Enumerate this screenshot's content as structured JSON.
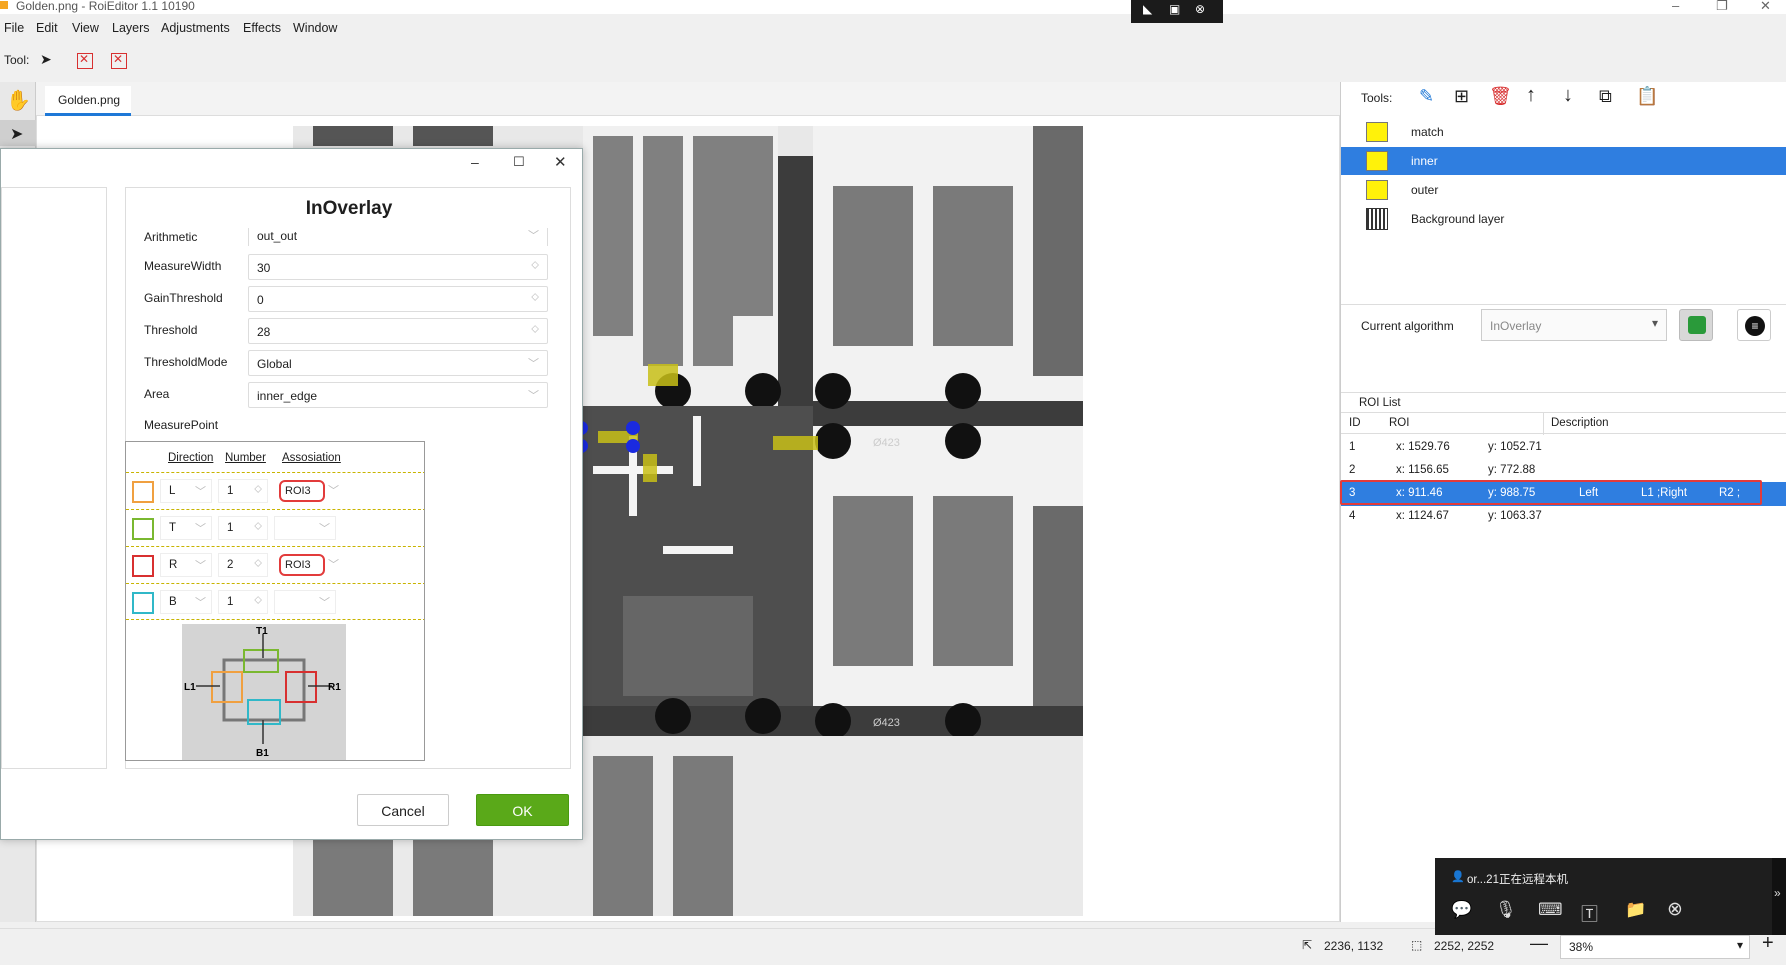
{
  "window": {
    "title": "Golden.png - RoiEditor 1.1 10190",
    "controls": [
      "–",
      "❐",
      "✕"
    ]
  },
  "menu": [
    "File",
    "Edit",
    "View",
    "Layers",
    "Adjustments",
    "Effects",
    "Window"
  ],
  "toolbar": {
    "tool_label": "Tool:"
  },
  "document_tab": "Golden.png",
  "right_panel": {
    "tools_label": "Tools:",
    "layers": [
      {
        "name": "match",
        "color": "#fff20a"
      },
      {
        "name": "inner",
        "color": "#fff20a",
        "selected": true
      },
      {
        "name": "outer",
        "color": "#fff20a"
      },
      {
        "name": "Background layer"
      }
    ],
    "current_algorithm_label": "Current algorithm",
    "current_algorithm_value": "InOverlay",
    "roi_list_title": "ROI List",
    "roi_columns": [
      "ID",
      "ROI",
      "Description"
    ],
    "roi_rows": [
      {
        "id": "1",
        "x": "x: 1529.76",
        "y": "y: 1052.71",
        "desc1": "",
        "desc2": "",
        "desc3": ""
      },
      {
        "id": "2",
        "x": "x: 1156.65",
        "y": "y: 772.88",
        "desc1": "",
        "desc2": "",
        "desc3": ""
      },
      {
        "id": "3",
        "x": "x: 911.46",
        "y": "y: 988.75",
        "desc1": "Left",
        "desc2": "L1 ;Right",
        "desc3": "R2 ;"
      },
      {
        "id": "4",
        "x": "x: 1124.67",
        "y": "y: 1063.37",
        "desc1": "",
        "desc2": "",
        "desc3": ""
      }
    ],
    "selected_roi": "3"
  },
  "image_labels": {
    "pad_label_1": "Ø423",
    "pad_label_2": "Ø423"
  },
  "dialog": {
    "title": "InOverlay",
    "properties": [
      {
        "label": "Arithmetic",
        "value": "out_out",
        "kind": "combo"
      },
      {
        "label": "MeasureWidth",
        "value": "30",
        "kind": "spin"
      },
      {
        "label": "GainThreshold",
        "value": "0",
        "kind": "spin"
      },
      {
        "label": "Threshold",
        "value": "28",
        "kind": "spin"
      },
      {
        "label": "ThresholdMode",
        "value": "Global",
        "kind": "combo"
      },
      {
        "label": "Area",
        "value": "inner_edge",
        "kind": "combo"
      }
    ],
    "measure_point_label": "MeasurePoint",
    "mp_headers": [
      "Direction",
      "Number",
      "Assosiation"
    ],
    "mp_rows": [
      {
        "color": "#f0a040",
        "direction": "L",
        "number": "1",
        "association": "ROI3"
      },
      {
        "color": "#7ab830",
        "direction": "T",
        "number": "1",
        "association": ""
      },
      {
        "color": "#d83030",
        "direction": "R",
        "number": "2",
        "association": "ROI3"
      },
      {
        "color": "#30b8c8",
        "direction": "B",
        "number": "1",
        "association": ""
      }
    ],
    "diagram_labels": {
      "top": "T1",
      "left": "L1",
      "right": "R1",
      "bottom": "B1"
    },
    "cancel_label": "Cancel",
    "ok_label": "OK"
  },
  "status": {
    "cursor_pos": "2236, 1132",
    "selection_size": "2252, 2252",
    "zoom": "38%"
  },
  "remote_panel": {
    "text": "or...21正在远程本机"
  }
}
